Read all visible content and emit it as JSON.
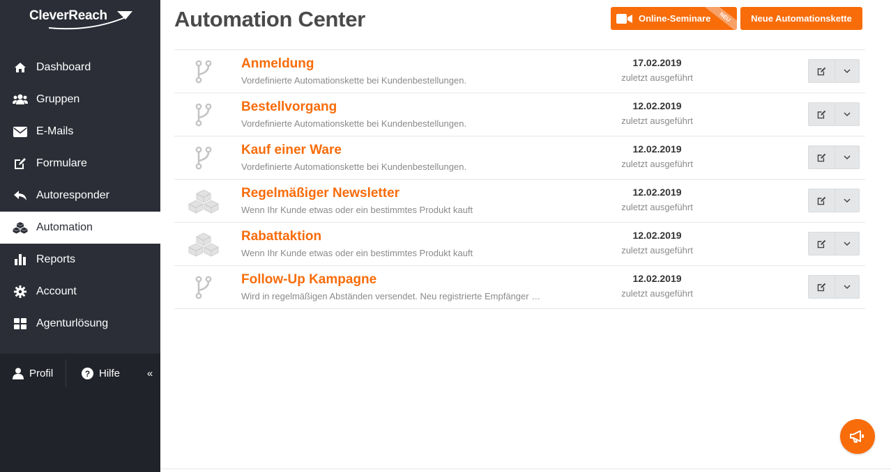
{
  "brand": {
    "logo_text": "CleverReach",
    "accent": "#f86c0a",
    "sidebar_bg": "#2b2e36"
  },
  "sidebar": {
    "items": [
      {
        "label": "Dashboard",
        "icon": "home-icon"
      },
      {
        "label": "Gruppen",
        "icon": "users-icon"
      },
      {
        "label": "E-Mails",
        "icon": "envelope-icon"
      },
      {
        "label": "Formulare",
        "icon": "edit-icon"
      },
      {
        "label": "Autoresponder",
        "icon": "reply-icon"
      },
      {
        "label": "Automation",
        "icon": "cubes-icon",
        "active": true
      },
      {
        "label": "Reports",
        "icon": "bar-chart-icon"
      },
      {
        "label": "Account",
        "icon": "gear-icon"
      },
      {
        "label": "Agenturlösung",
        "icon": "grid-icon"
      }
    ],
    "profile_label": "Profil",
    "help_label": "Hilfe",
    "collapse_glyph": "«"
  },
  "header": {
    "title": "Automation Center",
    "seminar_button": "Online-Seminare",
    "seminar_badge": "NEU",
    "new_button": "Neue Automationskette"
  },
  "automations": [
    {
      "title": "Anmeldung",
      "description": "Vordefinierte Automationskette bei Kundenbestellungen.",
      "date": "17.02.2019",
      "executed": "zuletzt ausgeführt",
      "icon": "branch-icon"
    },
    {
      "title": "Bestellvorgang",
      "description": "Vordefinierte Automationskette bei Kundenbestellungen.",
      "date": "12.02.2019",
      "executed": "zuletzt ausgeführt",
      "icon": "branch-icon"
    },
    {
      "title": "Kauf einer Ware",
      "description": "Vordefinierte Automationskette bei Kundenbestellungen.",
      "date": "12.02.2019",
      "executed": "zuletzt ausgeführt",
      "icon": "branch-icon"
    },
    {
      "title": "Regelmäßiger Newsletter",
      "description": "Wenn Ihr Kunde etwas oder ein bestimmtes Produkt kauft",
      "date": "12.02.2019",
      "executed": "zuletzt ausgeführt",
      "icon": "cubes-icon"
    },
    {
      "title": "Rabattaktion",
      "description": "Wenn Ihr Kunde etwas oder ein bestimmtes Produkt kauft",
      "date": "12.02.2019",
      "executed": "zuletzt ausgeführt",
      "icon": "cubes-icon"
    },
    {
      "title": "Follow-Up Kampagne",
      "description": "Wird in regelmäßigen Abständen versendet. Neu registrierte Empfänger …",
      "date": "12.02.2019",
      "executed": "zuletzt ausgeführt",
      "icon": "branch-icon"
    }
  ]
}
